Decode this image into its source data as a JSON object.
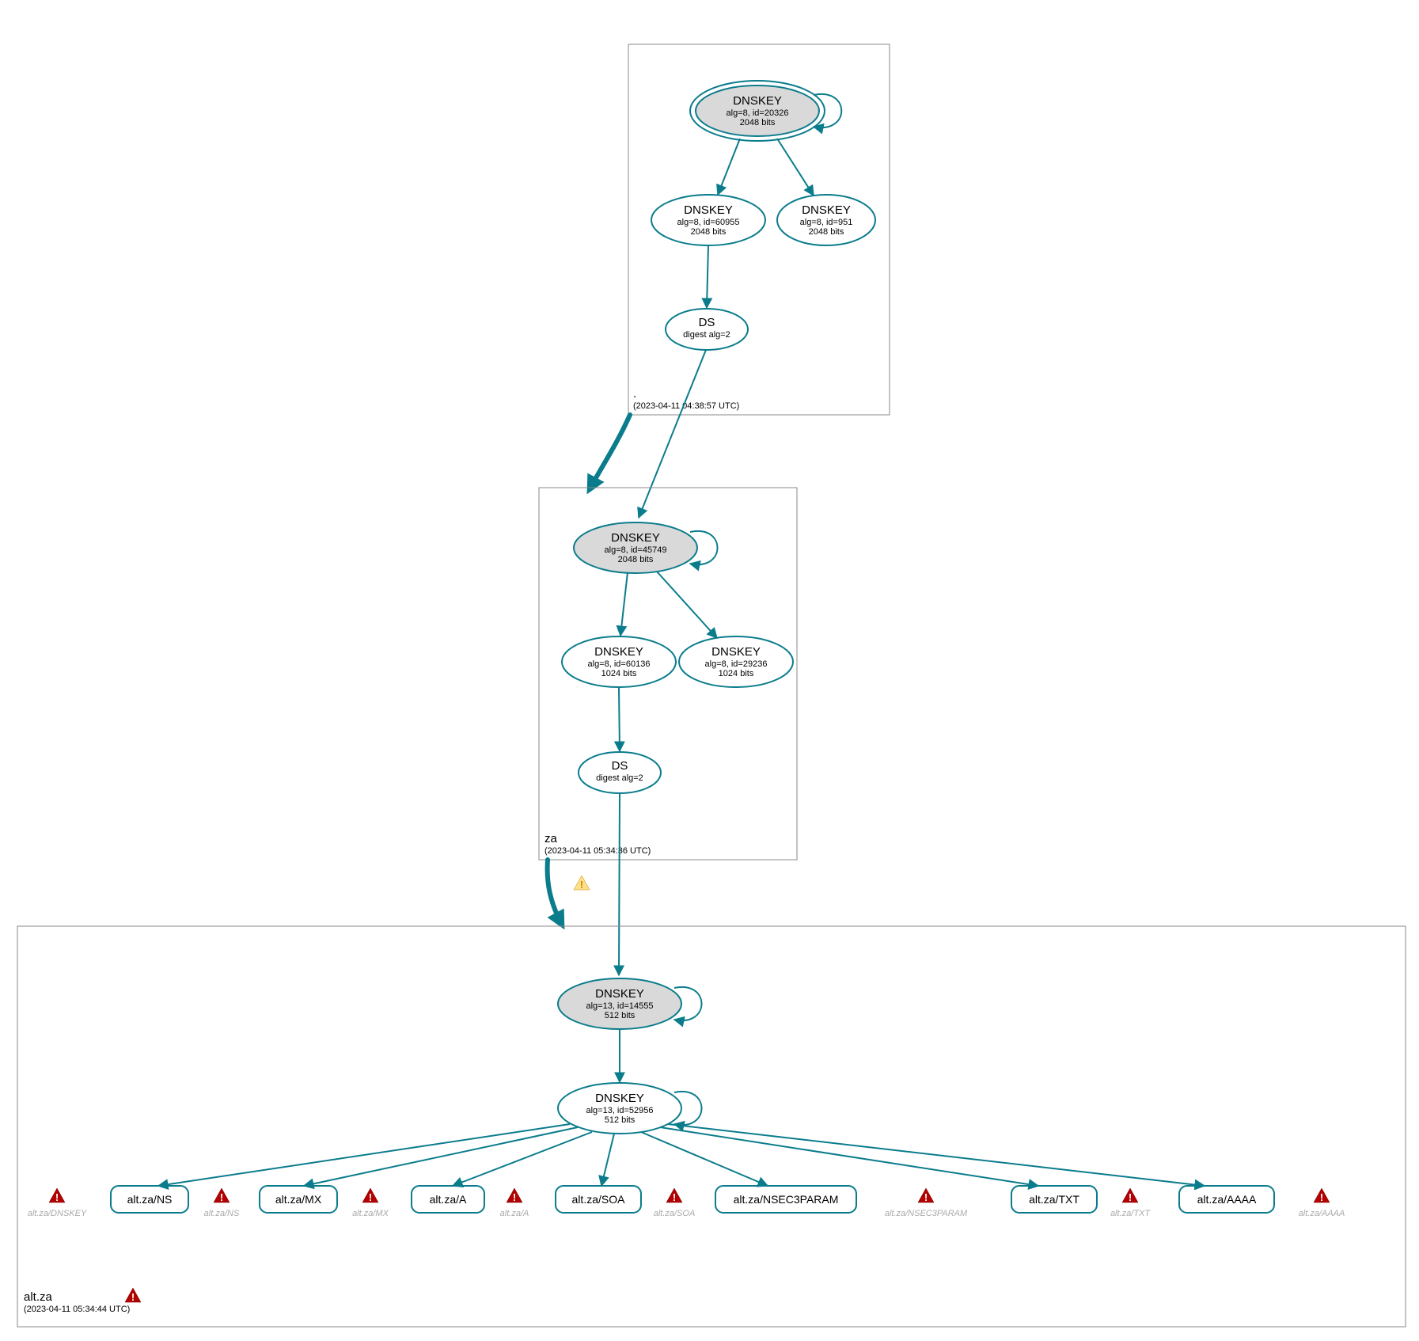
{
  "zones": {
    "root": {
      "label": ".",
      "timestamp": "(2023-04-11 04:38:57 UTC)",
      "nodes": {
        "ksk": {
          "title": "DNSKEY",
          "line2": "alg=8, id=20326",
          "line3": "2048 bits"
        },
        "zsk1": {
          "title": "DNSKEY",
          "line2": "alg=8, id=60955",
          "line3": "2048 bits"
        },
        "zsk2": {
          "title": "DNSKEY",
          "line2": "alg=8, id=951",
          "line3": "2048 bits"
        },
        "ds": {
          "title": "DS",
          "line2": "digest alg=2"
        }
      }
    },
    "za": {
      "label": "za",
      "timestamp": "(2023-04-11 05:34:36 UTC)",
      "nodes": {
        "ksk": {
          "title": "DNSKEY",
          "line2": "alg=8, id=45749",
          "line3": "2048 bits"
        },
        "zsk1": {
          "title": "DNSKEY",
          "line2": "alg=8, id=60136",
          "line3": "1024 bits"
        },
        "zsk2": {
          "title": "DNSKEY",
          "line2": "alg=8, id=29236",
          "line3": "1024 bits"
        },
        "ds": {
          "title": "DS",
          "line2": "digest alg=2"
        }
      }
    },
    "altza": {
      "label": "alt.za",
      "timestamp": "(2023-04-11 05:34:44 UTC)",
      "nodes": {
        "ksk": {
          "title": "DNSKEY",
          "line2": "alg=13, id=14555",
          "line3": "512 bits"
        },
        "zsk": {
          "title": "DNSKEY",
          "line2": "alg=13, id=52956",
          "line3": "512 bits"
        }
      },
      "records": [
        "alt.za/NS",
        "alt.za/MX",
        "alt.za/A",
        "alt.za/SOA",
        "alt.za/NSEC3PARAM",
        "alt.za/TXT",
        "alt.za/AAAA"
      ],
      "greyed": [
        "alt.za/DNSKEY",
        "alt.za/NS",
        "alt.za/MX",
        "alt.za/A",
        "alt.za/SOA",
        "alt.za/NSEC3PARAM",
        "alt.za/TXT",
        "alt.za/AAAA"
      ]
    }
  }
}
